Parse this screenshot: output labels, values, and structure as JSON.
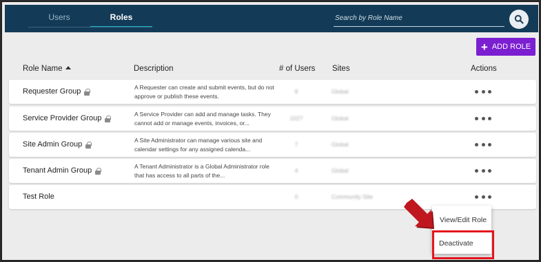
{
  "tabs": [
    {
      "label": "Users"
    },
    {
      "label": "Roles"
    }
  ],
  "search": {
    "placeholder": "Search by Role Name",
    "icon": "search-icon"
  },
  "add_role_label": "ADD ROLE",
  "table": {
    "headers": {
      "name": "Role Name",
      "description": "Description",
      "users": "# of Users",
      "sites": "Sites",
      "actions": "Actions"
    },
    "rows": [
      {
        "name": "Requester Group",
        "locked": true,
        "description": "A Requester can create and submit events, but do not approve or publish these events.",
        "users": "8",
        "sites": "Global"
      },
      {
        "name": "Service Provider Group",
        "locked": true,
        "description": "A Service Provider can add and manage tasks. They cannot add or manage events, invoices, or...",
        "users": "1027",
        "sites": "Global"
      },
      {
        "name": "Site Admin Group",
        "locked": true,
        "description": "A Site Administrator can manage various site and calendar settings for any assigned calenda...",
        "users": "7",
        "sites": "Global"
      },
      {
        "name": "Tenant Admin Group",
        "locked": true,
        "description": "A Tenant Administrator is a Global Administrator role that has access to all parts of the...",
        "users": "4",
        "sites": "Global"
      },
      {
        "name": "Test Role",
        "locked": false,
        "description": "",
        "users": "0",
        "sites": "Community Site"
      }
    ]
  },
  "menu": {
    "view_edit": "View/Edit Role",
    "deactivate": "Deactivate"
  },
  "colors": {
    "topbar": "#133b57",
    "accent": "#7b1fd1",
    "tab_underline": "#1fb3c4",
    "highlight": "#e4141d",
    "arrow": "#c0171e"
  }
}
